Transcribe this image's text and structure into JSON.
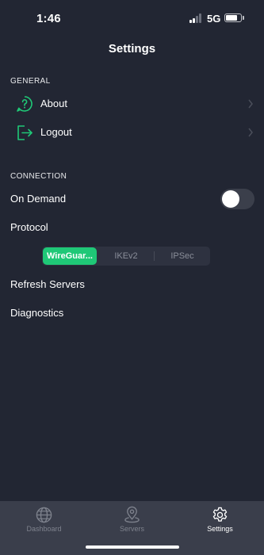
{
  "status_bar": {
    "time": "1:46",
    "network": "5G",
    "signal_bars_active": 2,
    "signal_bars_total": 4,
    "battery_level": 0.8
  },
  "header": {
    "title": "Settings"
  },
  "general": {
    "header": "GENERAL",
    "items": [
      {
        "label": "About",
        "icon": "question-circle-icon"
      },
      {
        "label": "Logout",
        "icon": "logout-icon"
      }
    ]
  },
  "connection": {
    "header": "CONNECTION",
    "on_demand": {
      "label": "On Demand",
      "enabled": false
    },
    "protocol": {
      "label": "Protocol",
      "options": [
        "WireGuar...",
        "IKEv2",
        "IPSec"
      ],
      "selected": "WireGuar..."
    },
    "refresh_label": "Refresh Servers",
    "diagnostics_label": "Diagnostics"
  },
  "tab_bar": {
    "tabs": [
      {
        "label": "Dashboard",
        "icon": "globe-icon",
        "selected": false
      },
      {
        "label": "Servers",
        "icon": "location-pin-icon",
        "selected": false
      },
      {
        "label": "Settings",
        "icon": "gear-icon",
        "selected": true
      }
    ]
  },
  "colors": {
    "background": "#222633",
    "accent": "#1fc877",
    "tab_bar": "#3a3e4b",
    "inactive": "#7e828d"
  }
}
